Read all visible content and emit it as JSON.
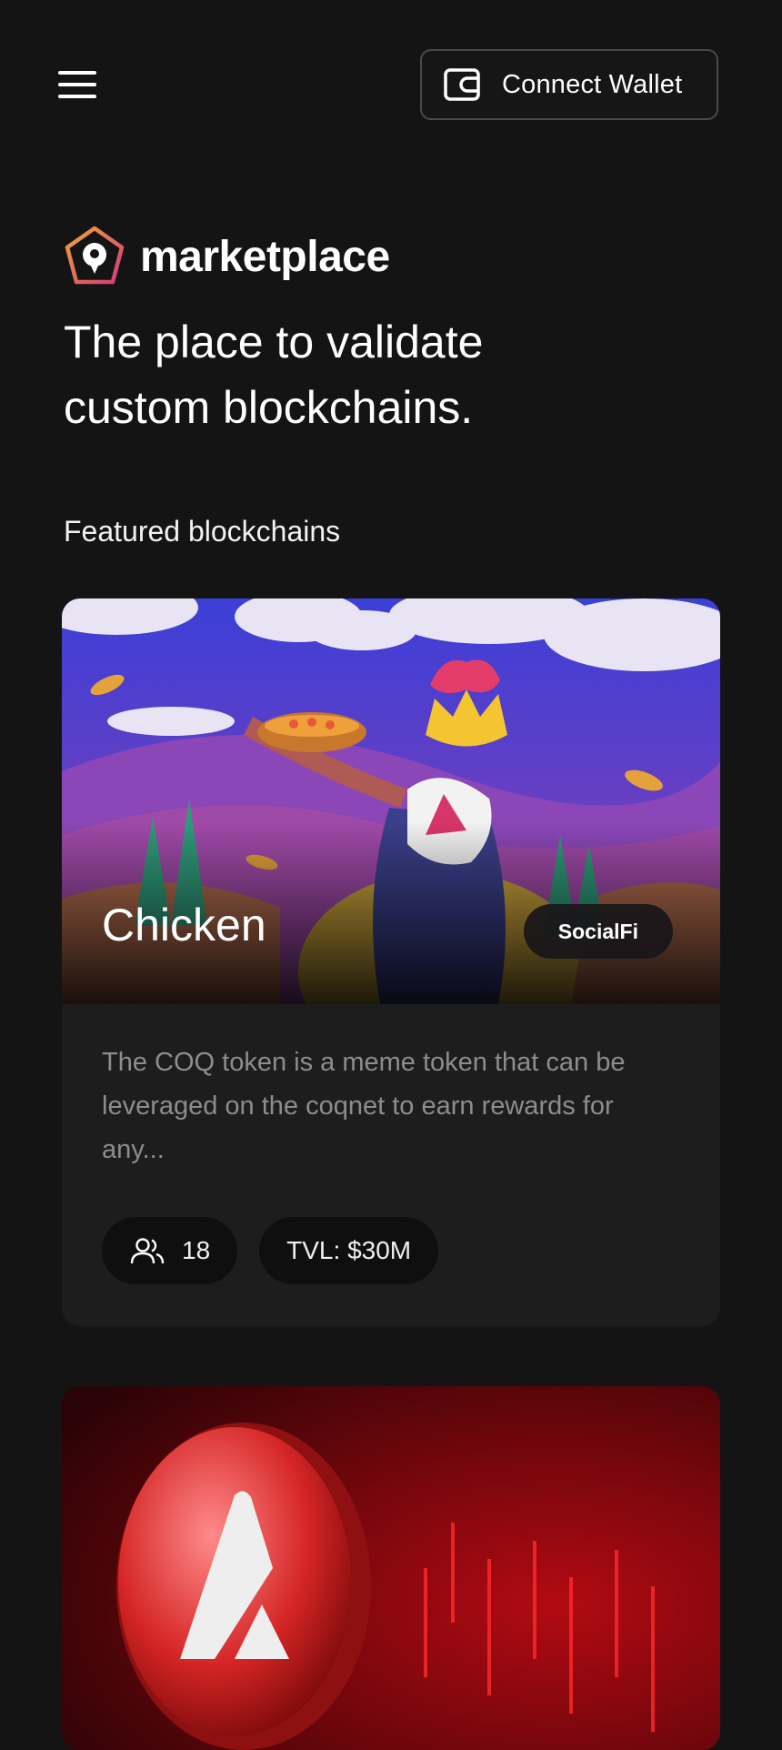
{
  "header": {
    "menu_icon": "hamburger-menu-icon",
    "wallet_button": {
      "icon": "wallet-icon",
      "label": "Connect Wallet"
    }
  },
  "brand": {
    "logo_icon": "map-pin-pentagon-logo",
    "name": "marketplace"
  },
  "hero": {
    "headline_line1": "The place to validate",
    "headline_line2": "custom blockchains."
  },
  "featured": {
    "title": "Featured blockchains",
    "cards": [
      {
        "title": "Chicken",
        "category": "SocialFi",
        "description": "The COQ token is a meme token that can be leveraged on the coqnet to earn rewards for any...",
        "validators_icon": "users-icon",
        "validators": "18",
        "tvl": "TVL: $30M",
        "image": "cartoon rooster with crown holding pizza"
      },
      {
        "image": "red avalanche coin over market chart"
      }
    ]
  },
  "colors": {
    "background": "#141414",
    "card": "#1e1d1e",
    "muted_text": "#8d8d8d",
    "logo_gradient_start": "#f4a23a",
    "logo_gradient_end": "#d23a7a"
  }
}
